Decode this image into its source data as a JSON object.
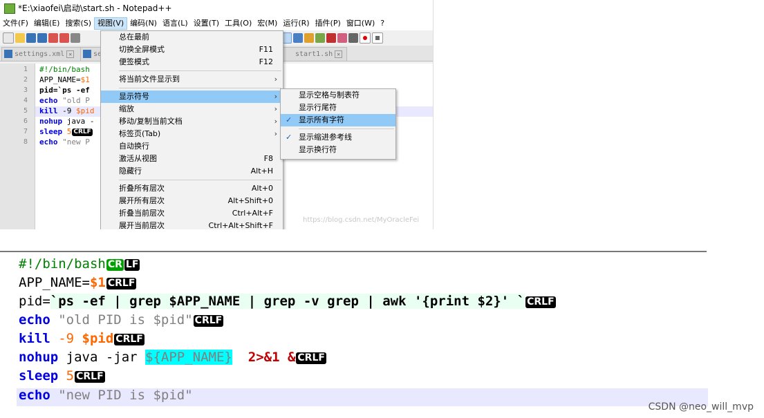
{
  "window": {
    "title": "*E:\\xiaofei\\启动\\start.sh - Notepad++"
  },
  "menubar": [
    {
      "label": "文件(F)"
    },
    {
      "label": "编辑(E)"
    },
    {
      "label": "搜索(S)"
    },
    {
      "label": "视图(V)",
      "active": true
    },
    {
      "label": "编码(N)"
    },
    {
      "label": "语言(L)"
    },
    {
      "label": "设置(T)"
    },
    {
      "label": "工具(O)"
    },
    {
      "label": "宏(M)"
    },
    {
      "label": "运行(R)"
    },
    {
      "label": "插件(P)"
    },
    {
      "label": "窗口(W)"
    },
    {
      "label": "?"
    }
  ],
  "tabs": [
    {
      "label": "settings.xml"
    },
    {
      "label": "se"
    },
    {
      "label": "start1.sh"
    }
  ],
  "editor_lines": [
    "1",
    "2",
    "3",
    "4",
    "5",
    "6",
    "7",
    "8"
  ],
  "small_code": {
    "l1": "#!/bin/bash",
    "l2a": "APP_NAME=",
    "l2b": "$1",
    "l3": "pid=`ps -ef",
    "l4a": "echo",
    "l4b": " \"old P",
    "l5a": "kill",
    "l5b": " -9 ",
    "l5c": "$pid",
    "l6a": "nohup",
    "l6b": " java -",
    "l7a": "sleep",
    "l7b": " 5",
    "l8a": "echo",
    "l8b": " \"new P"
  },
  "view_menu": {
    "always_on_top": "总在最前",
    "fullscreen": "切换全屏模式",
    "fullscreen_sc": "F11",
    "postit": "便签模式",
    "postit_sc": "F12",
    "show_in": "将当前文件显示到",
    "show_symbol": "显示符号",
    "zoom": "缩放",
    "move_clone": "移动/复制当前文档",
    "tab": "标签页(Tab)",
    "word_wrap": "自动换行",
    "activate_view": "激活从视图",
    "activate_view_sc": "F8",
    "hide_lines": "隐藏行",
    "hide_lines_sc": "Alt+H",
    "fold_all": "折叠所有层次",
    "fold_all_sc": "Alt+0",
    "unfold_all": "展开所有层次",
    "unfold_all_sc": "Alt+Shift+0",
    "fold_current": "折叠当前层次",
    "fold_current_sc": "Ctrl+Alt+F",
    "unfold_current": "展开当前层次",
    "unfold_current_sc": "Ctrl+Alt+Shift+F"
  },
  "symbol_menu": {
    "show_space_tab": "显示空格与制表符",
    "show_eol": "显示行尾符",
    "show_all": "显示所有字符",
    "show_indent_guide": "显示缩进参考线",
    "show_wrap": "显示换行符"
  },
  "watermark": "https://blog.csdn.net/MyOracleFei",
  "big_code": {
    "l1": "#!/bin/bash",
    "l2a": "APP_NAME=",
    "l2b": "$1",
    "l3a": "pid=",
    "l3b": "`ps -ef | grep $APP_NAME | grep -v grep | awk '{print $2}' `",
    "l4a": "echo",
    "l4b": " \"old PID is $pid\"",
    "l5a": "kill",
    "l5b": " -9 ",
    "l5c": "$pid",
    "l6a": "nohup",
    "l6b": " java -jar ",
    "l6c": "${APP_NAME}",
    "l6d": "  2>&1 &",
    "l7a": "sleep",
    "l7b": " 5",
    "l8a": "echo",
    "l8b": " \"new PID is $pid\""
  },
  "eol": {
    "cr": "CR",
    "lf": "LF"
  },
  "credit": "CSDN @neo_will_mvp"
}
